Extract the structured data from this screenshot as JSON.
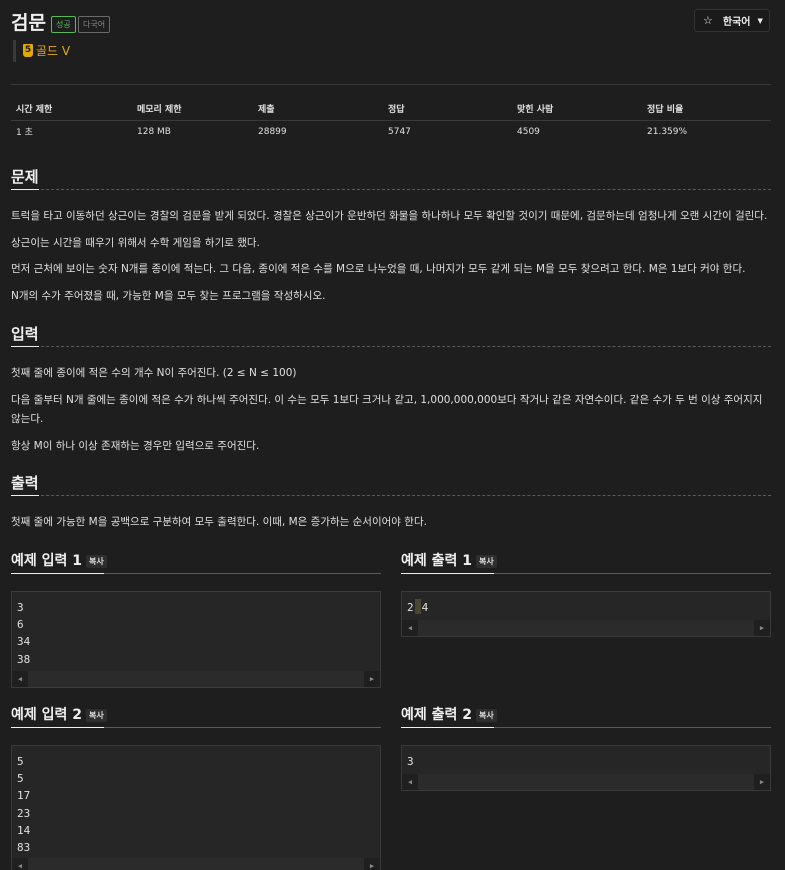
{
  "header": {
    "title": "검문",
    "badge_success": "성공",
    "badge_multilang": "다국어",
    "tier_number": "5",
    "tier_label": "골드 V",
    "language_button": "한국어",
    "star_icon": "star-icon",
    "caret_icon": "chevron-down-icon"
  },
  "stats": {
    "headers": [
      "시간 제한",
      "메모리 제한",
      "제출",
      "정답",
      "맞힌 사람",
      "정답 비율"
    ],
    "values": [
      "1 초",
      "128 MB",
      "28899",
      "5747",
      "4509",
      "21.359%"
    ]
  },
  "problem": {
    "heading": "문제",
    "paragraphs": [
      "트럭을 타고 이동하던 상근이는 경찰의 검문을 받게 되었다. 경찰은 상근이가 운반하던 화물을 하나하나 모두 확인할 것이기 때문에, 검문하는데 엄청나게 오랜 시간이 걸린다.",
      "상근이는 시간을 때우기 위해서 수학 게임을 하기로 했다.",
      "먼저 근처에 보이는 숫자 N개를 종이에 적는다. 그 다음, 종이에 적은 수를 M으로 나누었을 때, 나머지가 모두 같게 되는 M을 모두 찾으려고 한다. M은 1보다 커야 한다.",
      "N개의 수가 주어졌을 때, 가능한 M을 모두 찾는 프로그램을 작성하시오."
    ]
  },
  "input": {
    "heading": "입력",
    "paragraphs": [
      "첫째 줄에 종이에 적은 수의 개수 N이 주어진다. (2 ≤ N ≤ 100)",
      "다음 줄부터 N개 줄에는 종이에 적은 수가 하나씩 주어진다. 이 수는 모두 1보다 크거나 같고, 1,000,000,000보다 작거나 같은 자연수이다. 같은 수가 두 번 이상 주어지지 않는다.",
      "항상 M이 하나 이상 존재하는 경우만 입력으로 주어진다."
    ]
  },
  "output": {
    "heading": "출력",
    "paragraphs": [
      "첫째 줄에 가능한 M을 공백으로 구분하여 모두 출력한다. 이때, M은 증가하는 순서이어야 한다."
    ]
  },
  "samples": {
    "copy_label": "복사",
    "input1": {
      "title": "예제 입력 1",
      "lines": [
        "3",
        "6",
        "34",
        "38"
      ]
    },
    "output1": {
      "title": "예제 출력 1",
      "text_a": "2",
      "text_b": "4"
    },
    "input2": {
      "title": "예제 입력 2",
      "lines": [
        "5",
        "5",
        "17",
        "23",
        "14",
        "83"
      ]
    },
    "output2": {
      "title": "예제 출력 2",
      "lines": [
        "3"
      ]
    },
    "scroll_left": "◀",
    "scroll_right": "▶"
  }
}
